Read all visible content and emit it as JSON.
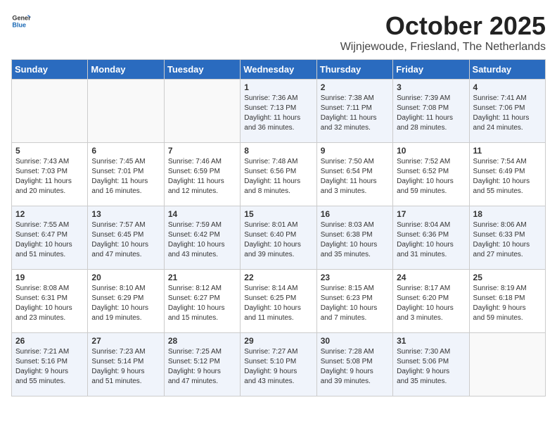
{
  "header": {
    "logo_general": "General",
    "logo_blue": "Blue",
    "month_title": "October 2025",
    "location": "Wijnjewoude, Friesland, The Netherlands"
  },
  "weekdays": [
    "Sunday",
    "Monday",
    "Tuesday",
    "Wednesday",
    "Thursday",
    "Friday",
    "Saturday"
  ],
  "weeks": [
    [
      {
        "day": "",
        "info": ""
      },
      {
        "day": "",
        "info": ""
      },
      {
        "day": "",
        "info": ""
      },
      {
        "day": "1",
        "info": "Sunrise: 7:36 AM\nSunset: 7:13 PM\nDaylight: 11 hours\nand 36 minutes."
      },
      {
        "day": "2",
        "info": "Sunrise: 7:38 AM\nSunset: 7:11 PM\nDaylight: 11 hours\nand 32 minutes."
      },
      {
        "day": "3",
        "info": "Sunrise: 7:39 AM\nSunset: 7:08 PM\nDaylight: 11 hours\nand 28 minutes."
      },
      {
        "day": "4",
        "info": "Sunrise: 7:41 AM\nSunset: 7:06 PM\nDaylight: 11 hours\nand 24 minutes."
      }
    ],
    [
      {
        "day": "5",
        "info": "Sunrise: 7:43 AM\nSunset: 7:03 PM\nDaylight: 11 hours\nand 20 minutes."
      },
      {
        "day": "6",
        "info": "Sunrise: 7:45 AM\nSunset: 7:01 PM\nDaylight: 11 hours\nand 16 minutes."
      },
      {
        "day": "7",
        "info": "Sunrise: 7:46 AM\nSunset: 6:59 PM\nDaylight: 11 hours\nand 12 minutes."
      },
      {
        "day": "8",
        "info": "Sunrise: 7:48 AM\nSunset: 6:56 PM\nDaylight: 11 hours\nand 8 minutes."
      },
      {
        "day": "9",
        "info": "Sunrise: 7:50 AM\nSunset: 6:54 PM\nDaylight: 11 hours\nand 3 minutes."
      },
      {
        "day": "10",
        "info": "Sunrise: 7:52 AM\nSunset: 6:52 PM\nDaylight: 10 hours\nand 59 minutes."
      },
      {
        "day": "11",
        "info": "Sunrise: 7:54 AM\nSunset: 6:49 PM\nDaylight: 10 hours\nand 55 minutes."
      }
    ],
    [
      {
        "day": "12",
        "info": "Sunrise: 7:55 AM\nSunset: 6:47 PM\nDaylight: 10 hours\nand 51 minutes."
      },
      {
        "day": "13",
        "info": "Sunrise: 7:57 AM\nSunset: 6:45 PM\nDaylight: 10 hours\nand 47 minutes."
      },
      {
        "day": "14",
        "info": "Sunrise: 7:59 AM\nSunset: 6:42 PM\nDaylight: 10 hours\nand 43 minutes."
      },
      {
        "day": "15",
        "info": "Sunrise: 8:01 AM\nSunset: 6:40 PM\nDaylight: 10 hours\nand 39 minutes."
      },
      {
        "day": "16",
        "info": "Sunrise: 8:03 AM\nSunset: 6:38 PM\nDaylight: 10 hours\nand 35 minutes."
      },
      {
        "day": "17",
        "info": "Sunrise: 8:04 AM\nSunset: 6:36 PM\nDaylight: 10 hours\nand 31 minutes."
      },
      {
        "day": "18",
        "info": "Sunrise: 8:06 AM\nSunset: 6:33 PM\nDaylight: 10 hours\nand 27 minutes."
      }
    ],
    [
      {
        "day": "19",
        "info": "Sunrise: 8:08 AM\nSunset: 6:31 PM\nDaylight: 10 hours\nand 23 minutes."
      },
      {
        "day": "20",
        "info": "Sunrise: 8:10 AM\nSunset: 6:29 PM\nDaylight: 10 hours\nand 19 minutes."
      },
      {
        "day": "21",
        "info": "Sunrise: 8:12 AM\nSunset: 6:27 PM\nDaylight: 10 hours\nand 15 minutes."
      },
      {
        "day": "22",
        "info": "Sunrise: 8:14 AM\nSunset: 6:25 PM\nDaylight: 10 hours\nand 11 minutes."
      },
      {
        "day": "23",
        "info": "Sunrise: 8:15 AM\nSunset: 6:23 PM\nDaylight: 10 hours\nand 7 minutes."
      },
      {
        "day": "24",
        "info": "Sunrise: 8:17 AM\nSunset: 6:20 PM\nDaylight: 10 hours\nand 3 minutes."
      },
      {
        "day": "25",
        "info": "Sunrise: 8:19 AM\nSunset: 6:18 PM\nDaylight: 9 hours\nand 59 minutes."
      }
    ],
    [
      {
        "day": "26",
        "info": "Sunrise: 7:21 AM\nSunset: 5:16 PM\nDaylight: 9 hours\nand 55 minutes."
      },
      {
        "day": "27",
        "info": "Sunrise: 7:23 AM\nSunset: 5:14 PM\nDaylight: 9 hours\nand 51 minutes."
      },
      {
        "day": "28",
        "info": "Sunrise: 7:25 AM\nSunset: 5:12 PM\nDaylight: 9 hours\nand 47 minutes."
      },
      {
        "day": "29",
        "info": "Sunrise: 7:27 AM\nSunset: 5:10 PM\nDaylight: 9 hours\nand 43 minutes."
      },
      {
        "day": "30",
        "info": "Sunrise: 7:28 AM\nSunset: 5:08 PM\nDaylight: 9 hours\nand 39 minutes."
      },
      {
        "day": "31",
        "info": "Sunrise: 7:30 AM\nSunset: 5:06 PM\nDaylight: 9 hours\nand 35 minutes."
      },
      {
        "day": "",
        "info": ""
      }
    ]
  ]
}
